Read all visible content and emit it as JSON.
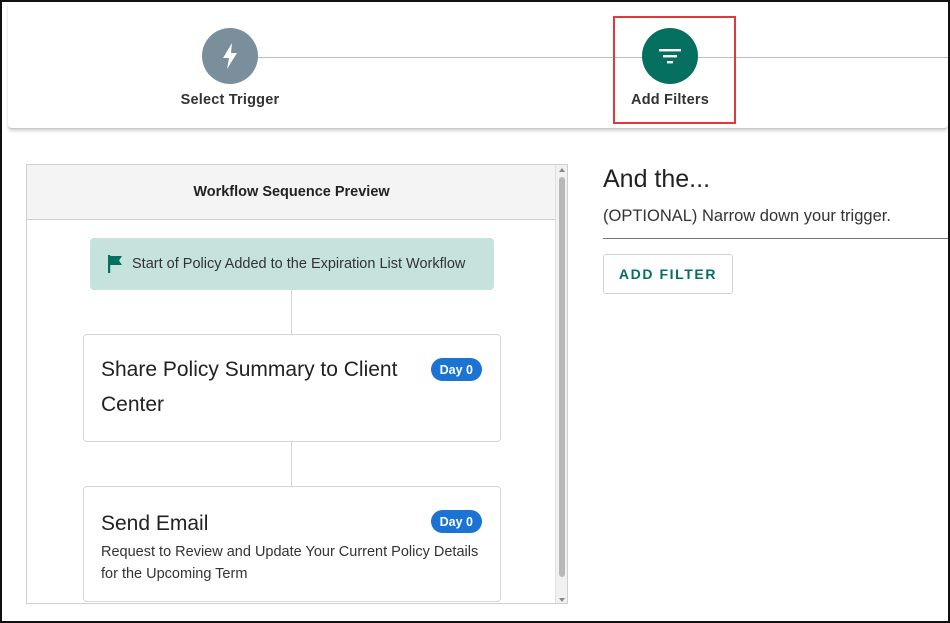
{
  "stepper": {
    "steps": [
      {
        "label": "Select Trigger",
        "icon": "lightning-bolt-icon",
        "color": "#7a8f9b",
        "active": false
      },
      {
        "label": "Add Filters",
        "icon": "filter-icon",
        "color": "#05705f",
        "active": true
      }
    ]
  },
  "preview": {
    "title": "Workflow Sequence Preview",
    "start_label": "Start of Policy Added to the Expiration List Workflow",
    "start_icon": "flag-icon",
    "steps": [
      {
        "title": "Share Policy Summary to Client Center",
        "badge": "Day 0",
        "description": ""
      },
      {
        "title": "Send Email",
        "badge": "Day 0",
        "description": "Request to Review and Update Your Current Policy Details for the Upcoming Term"
      }
    ]
  },
  "filters": {
    "heading": "And the...",
    "subheading": "(OPTIONAL) Narrow down your trigger.",
    "add_button": "ADD FILTER"
  },
  "colors": {
    "accent": "#05705f",
    "badge": "#1b73d3",
    "start_chip": "#c5e2dc",
    "highlight": "#e0393b"
  }
}
